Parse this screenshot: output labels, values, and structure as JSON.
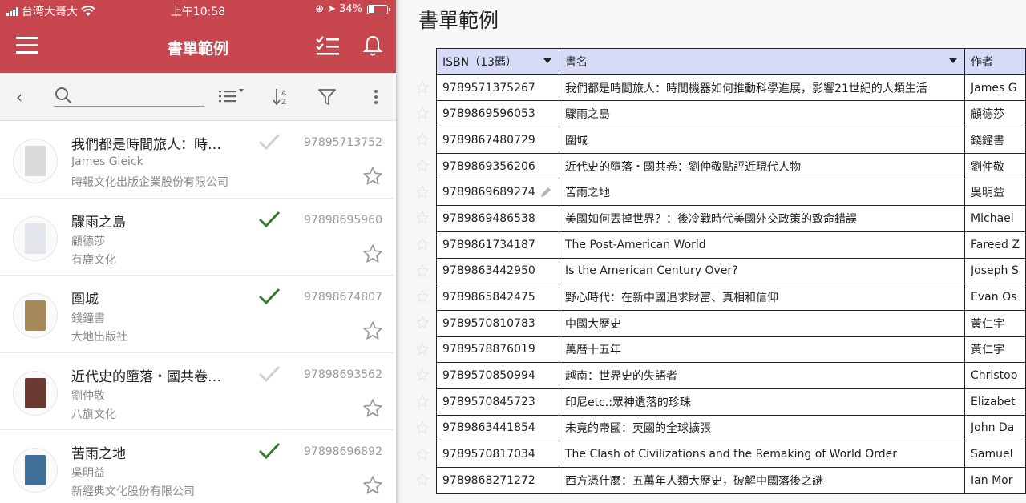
{
  "status_bar": {
    "carrier": "台湾大哥大",
    "time": "上午10:58",
    "battery_text": "34%",
    "battery_level": 0.34
  },
  "app_bar": {
    "title": "書單範例"
  },
  "search": {
    "value": "",
    "placeholder": ""
  },
  "books": [
    {
      "title": "我們都是時間旅人：時…",
      "author": "James Gleick",
      "publisher": "時報文化出版企業股份有限公司",
      "isbn": "97895713752",
      "checked": false,
      "cover_color": "#d9d9d9"
    },
    {
      "title": "驟雨之島",
      "author": "顧德莎",
      "publisher": "有鹿文化",
      "isbn": "97898695960",
      "checked": true,
      "cover_color": "#e2e6ea"
    },
    {
      "title": "圍城",
      "author": "錢鐘書",
      "publisher": "大地出版社",
      "isbn": "97898674807",
      "checked": true,
      "cover_color": "#a88a5a"
    },
    {
      "title": "近代史的墮落・國共卷…",
      "author": "劉仲敬",
      "publisher": "八旗文化",
      "isbn": "97898693562",
      "checked": false,
      "cover_color": "#6b3b33"
    },
    {
      "title": "苦雨之地",
      "author": "吳明益",
      "publisher": "新經典文化股份有限公司",
      "isbn": "97898696892",
      "checked": true,
      "cover_color": "#3f6f96"
    }
  ],
  "sheet": {
    "title": "書單範例",
    "columns": [
      "ISBN（13碼）",
      "書名",
      "作者"
    ],
    "rows": [
      [
        "9789571375267",
        "我們都是時間旅人：時間機器如何推動科學進展，影響21世紀的人類生活",
        "James G"
      ],
      [
        "9789869596053",
        "驟雨之島",
        "顧德莎"
      ],
      [
        "9789867480729",
        "圍城",
        "錢鐘書"
      ],
      [
        "9789869356206",
        "近代史的墮落・國共卷：劉仲敬點評近現代人物",
        "劉仲敬"
      ],
      [
        "9789869689274",
        "苦雨之地",
        "吳明益"
      ],
      [
        "9789869486538",
        "美國如何丟掉世界？：後冷戰時代美國外交政策的致命錯誤",
        "Michael"
      ],
      [
        "9789861734187",
        "The Post-American World",
        "Fareed Z"
      ],
      [
        "9789863442950",
        "Is the American Century Over?",
        "Joseph S"
      ],
      [
        "9789865842475",
        "野心時代：在新中國追求財富、真相和信仰",
        "Evan Os"
      ],
      [
        "9789570810783",
        "中國大歷史",
        "黃仁宇"
      ],
      [
        "9789578876019",
        "萬曆十五年",
        "黃仁宇"
      ],
      [
        "9789570850994",
        "越南：世界史的失語者",
        "Christop"
      ],
      [
        "9789570845723",
        "印尼etc.:眾神遺落的珍珠",
        "Elizabet"
      ],
      [
        "9789863441854",
        "未竟的帝國：英國的全球擴張",
        "John Da"
      ],
      [
        "9789570817034",
        "The Clash of Civilizations and the Remaking of World Order",
        "Samuel"
      ],
      [
        "9789868271272",
        "西方憑什麼：五萬年人類大歷史，破解中國落後之謎",
        "Ian Mor"
      ]
    ]
  },
  "colors": {
    "brand_red": "#c8474f",
    "check_green": "#2e7d32",
    "check_gray": "#d0d0d0",
    "header_blue": "#d6dcf5"
  },
  "icons": {
    "menu": "hamburger-menu-icon",
    "checklist": "checklist-icon",
    "bell": "bell-icon",
    "back": "chevron-left-icon",
    "search": "search-icon",
    "list": "list-sort-icon",
    "sort_az": "sort-alpha-icon",
    "filter": "filter-icon",
    "more": "more-vert-icon",
    "star": "star-outline-icon",
    "check": "check-icon",
    "pencil": "pencil-icon"
  }
}
